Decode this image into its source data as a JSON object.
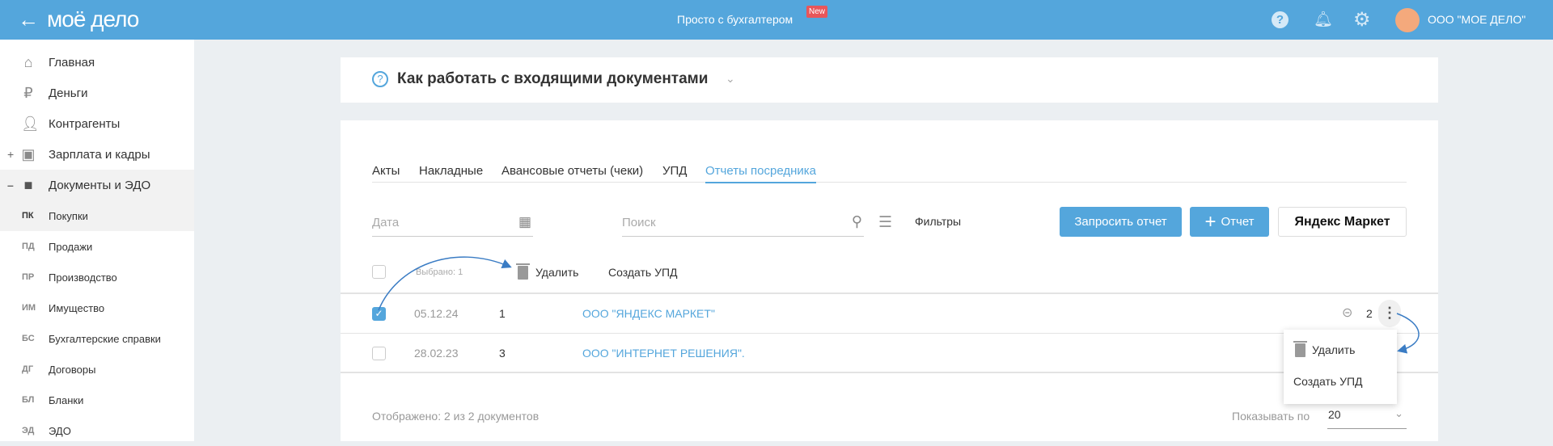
{
  "header": {
    "logo": "моё дело",
    "promo": "Просто с бухгалтером",
    "promo_badge": "New",
    "company": "ООО \"МОЕ ДЕЛО\"",
    "icons": [
      "arrow-left-icon",
      "help-icon",
      "bell-icon",
      "gear-icon"
    ],
    "accent": "#54a6dc",
    "badge_color": "#e8565a",
    "avatar_color": "#f4a97c"
  },
  "sidebar": {
    "items": [
      {
        "label": "Главная",
        "icon": "home-icon"
      },
      {
        "label": "Деньги",
        "icon": "money-icon"
      },
      {
        "label": "Контрагенты",
        "icon": "person-icon"
      },
      {
        "label": "Зарплата и кадры",
        "icon": "payroll-icon",
        "toggle": "+"
      },
      {
        "label": "Документы и ЭДО",
        "icon": "folder-icon",
        "toggle": "–"
      }
    ],
    "subitems": [
      {
        "abbr": "ПК",
        "label": "Покупки"
      },
      {
        "abbr": "ПД",
        "label": "Продажи"
      },
      {
        "abbr": "ПР",
        "label": "Производство"
      },
      {
        "abbr": "ИМ",
        "label": "Имущество"
      },
      {
        "abbr": "БС",
        "label": "Бухгалтерские справки"
      },
      {
        "abbr": "ДГ",
        "label": "Договоры"
      },
      {
        "abbr": "БЛ",
        "label": "Бланки"
      },
      {
        "abbr": "ЭД",
        "label": "ЭДО"
      }
    ]
  },
  "help": {
    "title": "Как работать с входящими документами"
  },
  "tabs": [
    {
      "label": "Акты"
    },
    {
      "label": "Накладные"
    },
    {
      "label": "Авансовые отчеты (чеки)"
    },
    {
      "label": "УПД"
    },
    {
      "label": "Отчеты посредника",
      "active": true
    }
  ],
  "filters": {
    "date_placeholder": "Дата",
    "search_placeholder": "Поиск",
    "filters_label": "Фильтры",
    "request_btn": "Запросить отчет",
    "add_btn": "Отчет",
    "market_btn": "Яндекс Маркет"
  },
  "bulk": {
    "selected": "Выбрано: 1",
    "delete": "Удалить",
    "create": "Создать УПД"
  },
  "rows": [
    {
      "checked": true,
      "date": "05.12.24",
      "number": "1",
      "org": "ООО \"ЯНДЕКС МАРКЕТ\"",
      "links": "2"
    },
    {
      "checked": false,
      "date": "28.02.23",
      "number": "3",
      "org": "ООО \"ИНТЕРНЕТ РЕШЕНИЯ\"."
    }
  ],
  "menu": {
    "delete": "Удалить",
    "create": "Создать УПД"
  },
  "footer": {
    "shown": "Отображено: 2 из 2 документов",
    "per_page_label": "Показывать по",
    "per_page": "20"
  }
}
